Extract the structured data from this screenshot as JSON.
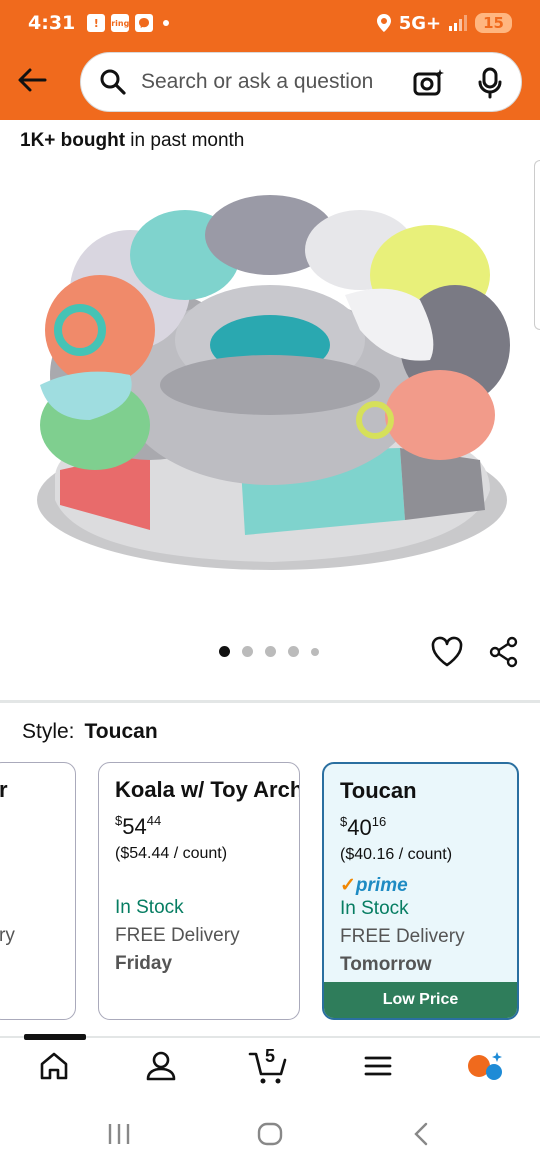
{
  "status": {
    "time": "4:31",
    "icon1": "!",
    "icon2": "ring",
    "icon3": "msg",
    "network": "5G+",
    "battery": "15"
  },
  "search": {
    "placeholder": "Search or ask a question"
  },
  "bought": {
    "bold": "1K+ bought",
    "rest": " in past month"
  },
  "gallery": {
    "dots": 5,
    "active": 0
  },
  "style": {
    "label": "Style:",
    "value": "Toucan"
  },
  "options": [
    {
      "name_frag": "r",
      "deliv_frag": "ry"
    },
    {
      "name": "Koala w/ Toy Arch",
      "dollar": "$",
      "whole": "54",
      "cents": "44",
      "unit": "($54.44 / count)",
      "stock": "In Stock",
      "delivery": "FREE Delivery",
      "day": "Friday"
    },
    {
      "name": "Toucan",
      "dollar": "$",
      "whole": "40",
      "cents": "16",
      "unit": "($40.16 / count)",
      "prime": "prime",
      "stock": "In Stock",
      "delivery": "FREE Delivery",
      "day": "Tomorrow",
      "badge": "Low Price"
    }
  ],
  "nav": {
    "cart_count": "5"
  },
  "colors": {
    "brand": "#f06a1d",
    "selected": "#2a6fa0",
    "stock": "#067d62",
    "badge": "#2f7d5b"
  }
}
